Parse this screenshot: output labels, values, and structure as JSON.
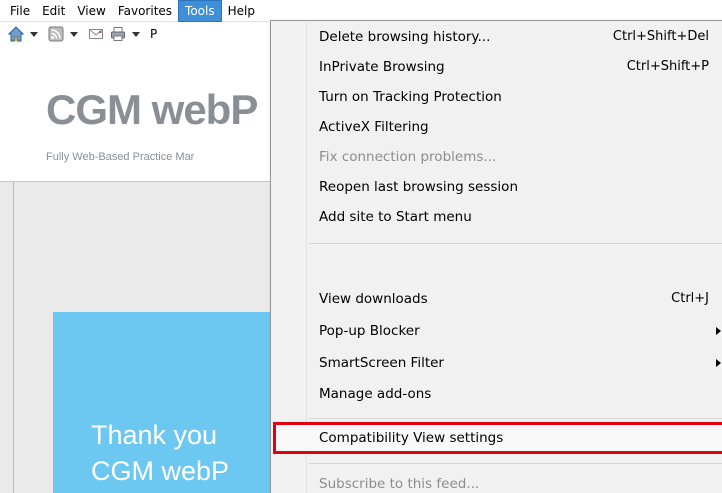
{
  "menubar": {
    "items": [
      {
        "label": "File"
      },
      {
        "label": "Edit"
      },
      {
        "label": "View"
      },
      {
        "label": "Favorites"
      },
      {
        "label": "Tools"
      },
      {
        "label": "Help"
      }
    ],
    "active": "Tools",
    "active_color": "#3f8fd8"
  },
  "toolbar": {
    "icons": [
      "home-icon",
      "rss-feed-icon",
      "mail-icon",
      "print-icon"
    ],
    "truncated_label": "P"
  },
  "page": {
    "logo_text": "CGM webP",
    "tagline": "Fully Web-Based Practice Mar",
    "hero_line_1": "Thank you",
    "hero_line_2": "CGM webP",
    "hero_color": "#6cc8f0"
  },
  "tools_menu": {
    "items": [
      {
        "label": "Delete browsing history...",
        "shortcut": "Ctrl+Shift+Del"
      },
      {
        "label": "InPrivate Browsing",
        "shortcut": "Ctrl+Shift+P"
      },
      {
        "label": "Turn on Tracking Protection",
        "shortcut": ""
      },
      {
        "label": "ActiveX Filtering",
        "shortcut": ""
      },
      {
        "label": "Fix connection problems...",
        "shortcut": "",
        "disabled": true
      },
      {
        "label": "Reopen last browsing session",
        "shortcut": ""
      },
      {
        "label": "Add site to Start menu",
        "shortcut": ""
      },
      {
        "label": "View downloads",
        "shortcut": "Ctrl+J"
      },
      {
        "label": "Pop-up Blocker",
        "shortcut": "",
        "submenu": true
      },
      {
        "label": "SmartScreen Filter",
        "shortcut": "",
        "submenu": true
      },
      {
        "label": "Manage add-ons",
        "shortcut": ""
      },
      {
        "label": "Compatibility View settings",
        "shortcut": "",
        "highlighted": true
      },
      {
        "label": "Subscribe to this feed...",
        "shortcut": "",
        "disabled": true
      }
    ],
    "highlight_color": "#e1000f"
  }
}
